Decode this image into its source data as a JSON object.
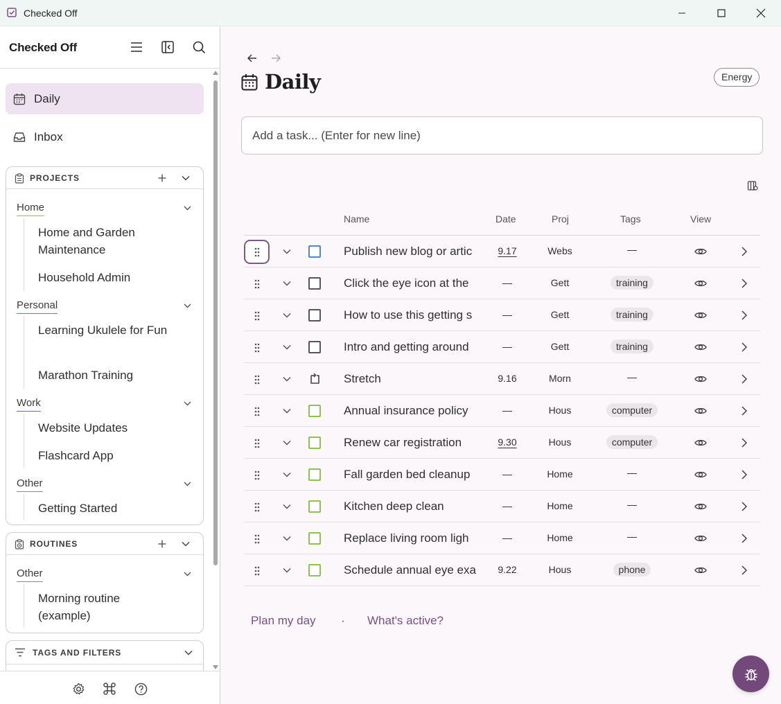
{
  "window": {
    "title": "Checked Off",
    "controls": [
      "minimize-icon",
      "maximize-icon",
      "close-icon"
    ]
  },
  "sidebar": {
    "brand": "Checked Off",
    "header_icons": [
      "menu-icon",
      "collapse-sidebar-icon",
      "search-icon"
    ],
    "nav": [
      {
        "label": "Daily",
        "icon": "calendar-icon",
        "active": true
      },
      {
        "label": "Inbox",
        "icon": "inbox-icon",
        "active": false
      }
    ],
    "projects": {
      "title": "PROJECTS",
      "groups": [
        {
          "label": "Home",
          "underline": "#8cc34a",
          "items": [
            "Home and Garden Maintenance",
            "Household Admin"
          ]
        },
        {
          "label": "Personal",
          "underline": "#c45aa0",
          "items": [
            "Learning Ukulele for Fun",
            "Marathon Training"
          ]
        },
        {
          "label": "Work",
          "underline": "#5a6ad8",
          "items": [
            "Website Updates",
            "Flashcard App"
          ]
        },
        {
          "label": "Other",
          "underline": "#8a8a8a",
          "items": [
            "Getting Started"
          ]
        }
      ]
    },
    "routines": {
      "title": "ROUTINES",
      "groups": [
        {
          "label": "Other",
          "underline": "#8a8a8a",
          "items": [
            "Morning routine (example)"
          ]
        }
      ]
    },
    "tags_filters": {
      "title": "TAGS AND FILTERS"
    },
    "footer_icons": [
      "settings-icon",
      "command-icon",
      "help-icon"
    ]
  },
  "main": {
    "title": "Daily",
    "energy_label": "Energy",
    "input_placeholder": "Add a task... (Enter for new line)",
    "columns": {
      "name": "Name",
      "date": "Date",
      "proj": "Proj",
      "tags": "Tags",
      "view": "View"
    },
    "tasks": [
      {
        "name": "Publish new blog or artic",
        "date": "9.17",
        "date_underlined": true,
        "proj": "Webs",
        "tags": "—",
        "checkbox": "blue",
        "focused": true
      },
      {
        "name": "Click the eye icon at the",
        "date": "—",
        "date_underlined": false,
        "proj": "Gett",
        "tags": "training",
        "checkbox": "gray"
      },
      {
        "name": "How to use this getting s",
        "date": "—",
        "date_underlined": false,
        "proj": "Gett",
        "tags": "training",
        "checkbox": "gray"
      },
      {
        "name": "Intro and getting around",
        "date": "—",
        "date_underlined": false,
        "proj": "Gett",
        "tags": "training",
        "checkbox": "gray"
      },
      {
        "name": "Stretch",
        "date": "9.16",
        "date_underlined": false,
        "proj": "Morn",
        "tags": "—",
        "checkbox": "repeat"
      },
      {
        "name": "Annual insurance policy",
        "date": "—",
        "date_underlined": false,
        "proj": "Hous",
        "tags": "computer",
        "checkbox": "green"
      },
      {
        "name": "Renew car registration",
        "date": "9.30",
        "date_underlined": true,
        "proj": "Hous",
        "tags": "computer",
        "checkbox": "green"
      },
      {
        "name": "Fall garden bed cleanup",
        "date": "—",
        "date_underlined": false,
        "proj": "Home",
        "tags": "—",
        "checkbox": "green"
      },
      {
        "name": "Kitchen deep clean",
        "date": "—",
        "date_underlined": false,
        "proj": "Home",
        "tags": "—",
        "checkbox": "green"
      },
      {
        "name": "Replace living room ligh",
        "date": "—",
        "date_underlined": false,
        "proj": "Home",
        "tags": "—",
        "checkbox": "green"
      },
      {
        "name": "Schedule annual eye exa",
        "date": "9.22",
        "date_underlined": false,
        "proj": "Hous",
        "tags": "phone",
        "checkbox": "green"
      }
    ],
    "footer_links": {
      "plan": "Plan my day",
      "separator": "·",
      "active": "What's active?"
    },
    "fab_icon": "bug-icon"
  },
  "colors": {
    "accent": "#73497c",
    "active_nav": "#efe2f1",
    "main_bg": "#fcf7fb"
  }
}
